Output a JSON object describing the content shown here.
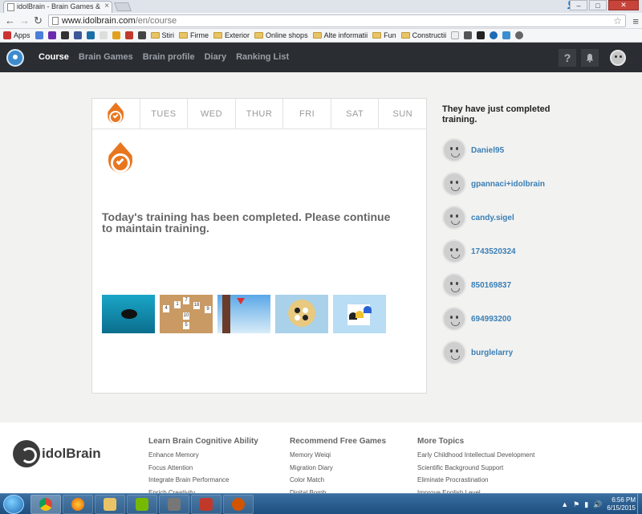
{
  "browser": {
    "tab_title": "idolBrain - Brain Games &",
    "url_host": "www.idolbrain.com",
    "url_path": "/en/course",
    "bookmarks": [
      "Apps",
      "Stiri",
      "Firme",
      "Exterior",
      "Online shops",
      "Alte informatii",
      "Fun",
      "Constructii"
    ]
  },
  "header": {
    "nav": [
      "Course",
      "Brain Games",
      "Brain profile",
      "Diary",
      "Ranking List"
    ],
    "help_glyph": "?"
  },
  "week": {
    "days": [
      "",
      "TUES",
      "WED",
      "THUR",
      "FRI",
      "SAT",
      "SUN"
    ]
  },
  "training": {
    "message": "Today's training has been completed. Please continue to maintain training.",
    "tile_numbers": [
      "1",
      "7",
      "4",
      "18",
      "9",
      "10",
      "5"
    ]
  },
  "sidebar": {
    "title": "They have just completed training.",
    "users": [
      "Daniel95",
      "gpannaci+idolbrain",
      "candy.sigel",
      "1743520324",
      "850169837",
      "694993200",
      "burglelarry"
    ]
  },
  "footer": {
    "logo_text": "idolBrain",
    "col1": {
      "title": "Learn Brain Cognitive Ability",
      "items": [
        "Enhance Memory",
        "Focus Attention",
        "Integrate Brain Performance",
        "Enrich Creativity"
      ]
    },
    "col2": {
      "title": "Recommend Free Games",
      "items": [
        "Memory Weiqi",
        "Migration Diary",
        "Color Match",
        "Digital Bomb"
      ]
    },
    "col3": {
      "title": "More Topics",
      "items": [
        "Early Childhood Intellectual Development",
        "Scientific Background Support",
        "Eliminate Procrastination",
        "Improve English Level"
      ]
    }
  },
  "taskbar": {
    "time": "6:56 PM",
    "date": "6/15/2015"
  },
  "colors": {
    "header_bg": "#2a2d31",
    "accent_orange": "#e8761f",
    "link_blue": "#3a7fb6"
  }
}
